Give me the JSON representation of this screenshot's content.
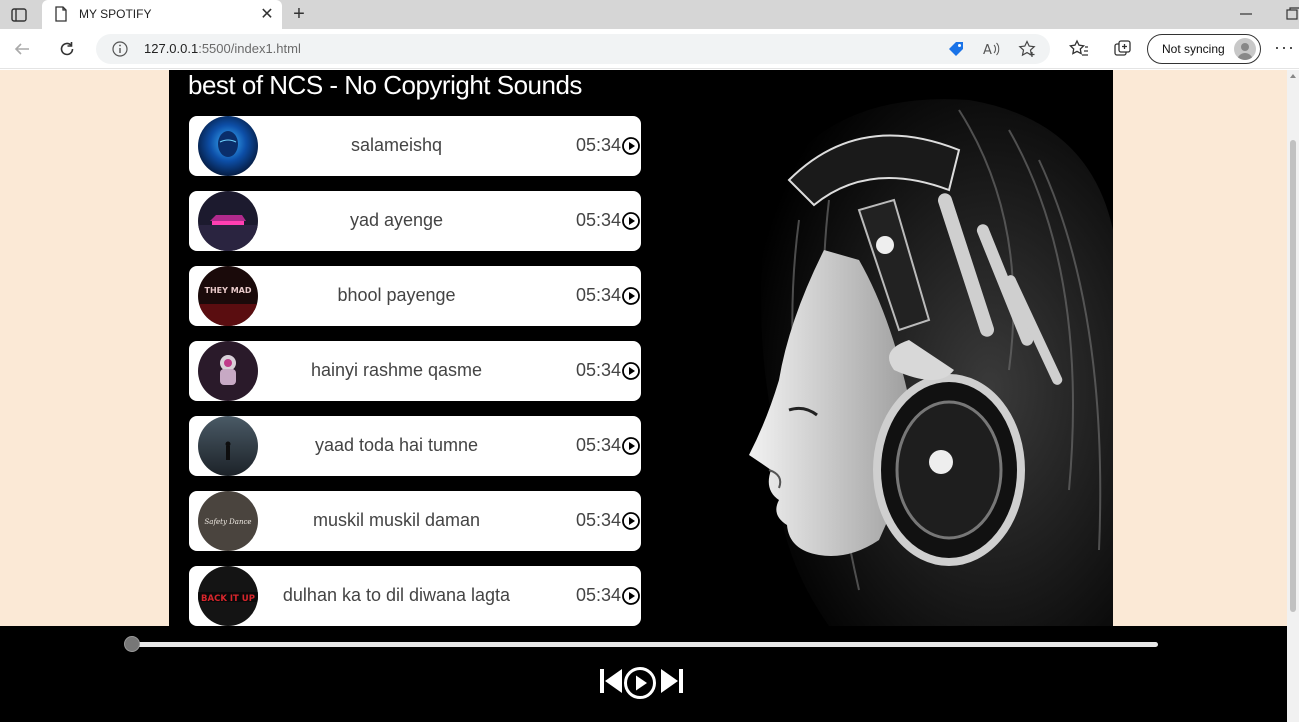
{
  "browser": {
    "tab_title": "MY SPOTIFY",
    "url_host": "127.0.0.1",
    "url_rest": ":5500/index1.html",
    "sync_label": "Not syncing"
  },
  "page": {
    "playlist_title": "best of NCS - No Copyright Sounds",
    "songs": [
      {
        "name": "salameishq",
        "duration": "05:34",
        "cover": "cover-blue-face"
      },
      {
        "name": "yad ayenge",
        "duration": "05:34",
        "cover": "cover-neon-car"
      },
      {
        "name": "bhool payenge",
        "duration": "05:34",
        "cover": "cover-they-mad"
      },
      {
        "name": "hainyi rashme qasme",
        "duration": "05:34",
        "cover": "cover-astronaut"
      },
      {
        "name": "yaad toda hai tumne",
        "duration": "05:34",
        "cover": "cover-foggy-figure"
      },
      {
        "name": "muskil muskil daman",
        "duration": "05:34",
        "cover": "cover-safety-dance"
      },
      {
        "name": "dulhan ka to dil diwana lagta",
        "duration": "05:34",
        "cover": "cover-back-it-up"
      }
    ],
    "cover_texts": {
      "they_mad": "THEY MAD",
      "safety_dance": "Safety Dance",
      "back_it_up": "BACK IT UP"
    },
    "progress": 0
  },
  "colors": {
    "page_background": "#fbe9d6",
    "container": "#000000",
    "song_card": "#ffffff"
  }
}
